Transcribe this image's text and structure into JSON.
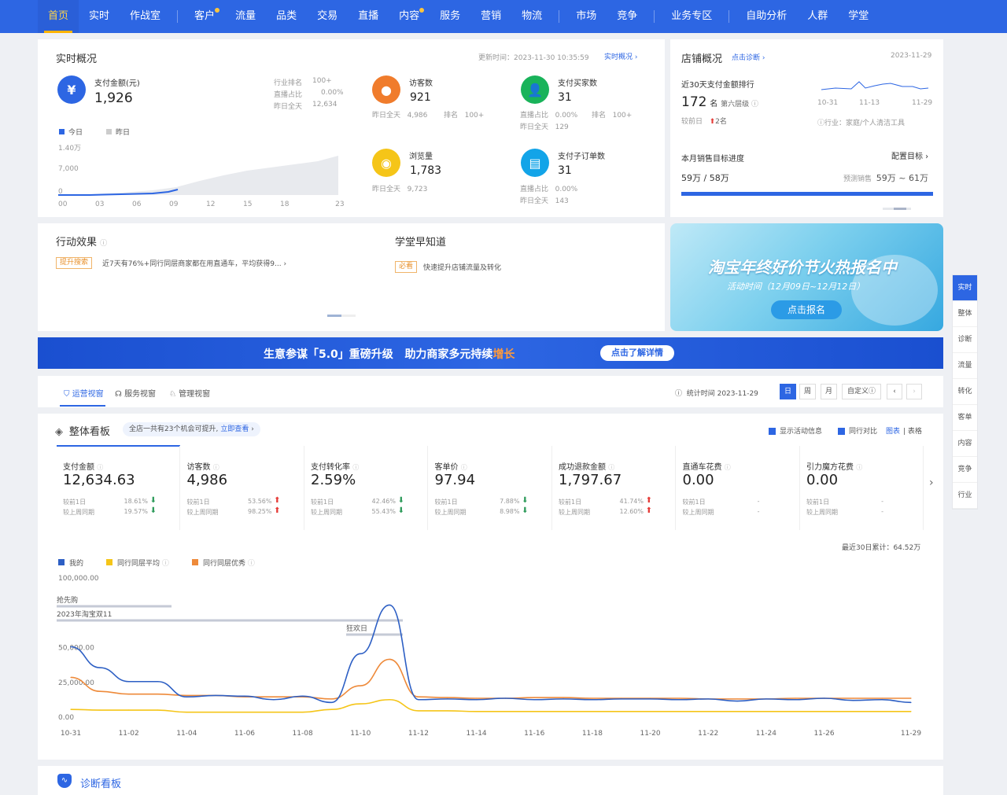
{
  "nav": {
    "items": [
      {
        "label": "首页",
        "active": true
      },
      {
        "label": "实时"
      },
      {
        "label": "作战室"
      },
      {
        "sep": true
      },
      {
        "label": "客户",
        "dot": true
      },
      {
        "label": "流量"
      },
      {
        "label": "品类"
      },
      {
        "label": "交易"
      },
      {
        "label": "直播"
      },
      {
        "label": "内容",
        "dot": true
      },
      {
        "label": "服务"
      },
      {
        "label": "营销"
      },
      {
        "label": "物流"
      },
      {
        "sep": true
      },
      {
        "label": "市场"
      },
      {
        "label": "竞争"
      },
      {
        "sep": true
      },
      {
        "label": "业务专区"
      },
      {
        "sep": true
      },
      {
        "label": "自助分析"
      },
      {
        "label": "人群"
      },
      {
        "label": "学堂"
      }
    ]
  },
  "realtime": {
    "title": "实时概况",
    "update": "更新时间：2023-11-30 10:35:59",
    "link": "实时概况",
    "pay_amount": {
      "label": "支付金额(元)",
      "value": "1,926",
      "rank_label": "行业排名",
      "rank_value": "100+",
      "live_label": "直播占比",
      "live_value": "0.00%",
      "yesterday_label": "昨日全天",
      "yesterday_value": "12,634"
    },
    "legend_today": "今日",
    "legend_yesterday": "昨日",
    "y_ticks": [
      "1.40万",
      "7,000",
      "0"
    ],
    "x_ticks": [
      "00",
      "03",
      "06",
      "09",
      "12",
      "15",
      "18",
      "23"
    ],
    "visitors": {
      "label": "访客数",
      "value": "921",
      "yesterday": "昨日全天",
      "yesterday_value": "4,986",
      "rank": "排名",
      "rank_value": "100+"
    },
    "buyers": {
      "label": "支付买家数",
      "value": "31",
      "live": "直播占比",
      "live_value": "0.00%",
      "rank": "排名",
      "rank_value": "100+",
      "yesterday": "昨日全天",
      "yesterday_value": "129"
    },
    "views": {
      "label": "浏览量",
      "value": "1,783",
      "yesterday": "昨日全天",
      "yesterday_value": "9,723"
    },
    "suborders": {
      "label": "支付子订单数",
      "value": "31",
      "live": "直播占比",
      "live_value": "0.00%",
      "yesterday": "昨日全天",
      "yesterday_value": "143"
    }
  },
  "shop": {
    "title": "店铺概况",
    "diag": "点击诊断",
    "date": "2023-11-29",
    "rank_title": "近30天支付金额排行",
    "rank_value": "172",
    "rank_unit": "名",
    "level": "第六层级",
    "compare": "较前日",
    "compare_value": "2名",
    "spark_x": [
      "10-31",
      "11-13",
      "11-29"
    ],
    "industry": "行业：家庭/个人清洁工具",
    "target_title": "本月销售目标进度",
    "target_link": "配置目标",
    "target_value": "59万 / 58万",
    "forecast_label": "预测销售",
    "forecast_value": "59万 ~ 61万",
    "progress": 100
  },
  "action": {
    "title": "行动效果",
    "tag": "提升搜索",
    "text": "近7天有76%+同行同层商家都在用直通车，平均获得9..."
  },
  "school": {
    "title": "学堂早知道",
    "tag": "必看",
    "text": "快速提升店铺流量及转化"
  },
  "promo": {
    "title": "淘宝年终好价节火热报名中",
    "sub": "活动时间（12月09日~12月12日）",
    "btn": "点击报名"
  },
  "banner": {
    "text1": "生意参谋「5.0」重磅升级",
    "text2": "助力商家多元持续",
    "text3": "增长",
    "btn": "点击了解详情"
  },
  "tabs": {
    "items": [
      "运营视窗",
      "服务视窗",
      "管理视窗"
    ],
    "stat_time": "统计时间 2023-11-29",
    "periods": [
      "日",
      "周",
      "月",
      "自定义"
    ]
  },
  "board": {
    "title": "整体看板",
    "tip": "全店一共有23个机会可提升,",
    "tip_link": "立即查看",
    "chk1": "显示活动信息",
    "chk2": "同行对比",
    "view1": "图表",
    "view2": "表格",
    "metrics": [
      {
        "label": "支付金额",
        "value": "12,634.63",
        "r1": "较前1日",
        "p1": "18.61%",
        "d1": "down",
        "r2": "较上周同期",
        "p2": "19.57%",
        "d2": "down"
      },
      {
        "label": "访客数",
        "value": "4,986",
        "r1": "较前1日",
        "p1": "53.56%",
        "d1": "up",
        "r2": "较上周同期",
        "p2": "98.25%",
        "d2": "up"
      },
      {
        "label": "支付转化率",
        "value": "2.59%",
        "r1": "较前1日",
        "p1": "42.46%",
        "d1": "down",
        "r2": "较上周同期",
        "p2": "55.43%",
        "d2": "down"
      },
      {
        "label": "客单价",
        "value": "97.94",
        "r1": "较前1日",
        "p1": "7.88%",
        "d1": "down",
        "r2": "较上周同期",
        "p2": "8.98%",
        "d2": "down"
      },
      {
        "label": "成功退款金额",
        "value": "1,797.67",
        "r1": "较前1日",
        "p1": "41.74%",
        "d1": "up",
        "r2": "较上周同期",
        "p2": "12.60%",
        "d2": "up"
      },
      {
        "label": "直通车花费",
        "value": "0.00",
        "r1": "较前1日",
        "p1": "-",
        "d1": "",
        "r2": "较上周同期",
        "p2": "-",
        "d2": ""
      },
      {
        "label": "引力魔方花费",
        "value": "0.00",
        "r1": "较前1日",
        "p1": "-",
        "d1": "",
        "r2": "较上周同期",
        "p2": "-",
        "d2": ""
      }
    ],
    "total": "最近30日累计：64.52万"
  },
  "chart_data": {
    "type": "line",
    "legend": [
      "我的",
      "同行同层平均",
      "同行同层优秀"
    ],
    "colors": [
      "#2d5fc4",
      "#f5c518",
      "#ee8a3a"
    ],
    "y_ticks": [
      "100,000.00",
      "50,000.00",
      "25,000.00",
      "0.00"
    ],
    "ylim": [
      0,
      100000
    ],
    "x": [
      "10-31",
      "11-01",
      "11-02",
      "11-03",
      "11-04",
      "11-05",
      "11-06",
      "11-07",
      "11-08",
      "11-09",
      "11-10",
      "11-11",
      "11-12",
      "11-13",
      "11-14",
      "11-15",
      "11-16",
      "11-17",
      "11-18",
      "11-19",
      "11-20",
      "11-21",
      "11-22",
      "11-23",
      "11-24",
      "11-25",
      "11-26",
      "11-27",
      "11-28",
      "11-29"
    ],
    "x_ticks": [
      "10-31",
      "11-02",
      "11-04",
      "11-06",
      "11-08",
      "11-10",
      "11-12",
      "11-14",
      "11-16",
      "11-18",
      "11-20",
      "11-22",
      "11-24",
      "11-26",
      "11-29"
    ],
    "series": [
      {
        "name": "我的",
        "values": [
          50000,
          35000,
          25000,
          25000,
          14000,
          15000,
          14500,
          12000,
          14500,
          10000,
          45000,
          80000,
          12000,
          12500,
          12000,
          13000,
          12000,
          12500,
          12000,
          12500,
          12500,
          12000,
          12500,
          11000,
          12500,
          12000,
          13000,
          11500,
          12000,
          10000
        ]
      },
      {
        "name": "同行同层平均",
        "values": [
          5000,
          4500,
          4500,
          4500,
          3000,
          3000,
          3000,
          3000,
          3000,
          5000,
          9000,
          12000,
          4000,
          4000,
          3500,
          3500,
          3500,
          3500,
          3500,
          3500,
          3500,
          3500,
          3500,
          3500,
          3500,
          3500,
          3500,
          3500,
          3500,
          3500
        ]
      },
      {
        "name": "同行同层优秀",
        "values": [
          28000,
          18000,
          16000,
          16000,
          15000,
          15000,
          14000,
          14000,
          14000,
          12500,
          22000,
          41000,
          14000,
          13500,
          13000,
          13000,
          13500,
          13500,
          13000,
          13000,
          13000,
          13000,
          12500,
          12500,
          12500,
          13000,
          13000,
          13000,
          13000,
          13000
        ]
      }
    ],
    "events": [
      {
        "label": "抢先购"
      },
      {
        "label": "2023年淘宝双11"
      },
      {
        "label": "狂欢日"
      }
    ]
  },
  "diag": {
    "title": "诊断看板"
  },
  "sidebar": [
    "实时",
    "整体",
    "诊断",
    "流量",
    "转化",
    "客单",
    "内容",
    "竞争",
    "行业"
  ]
}
